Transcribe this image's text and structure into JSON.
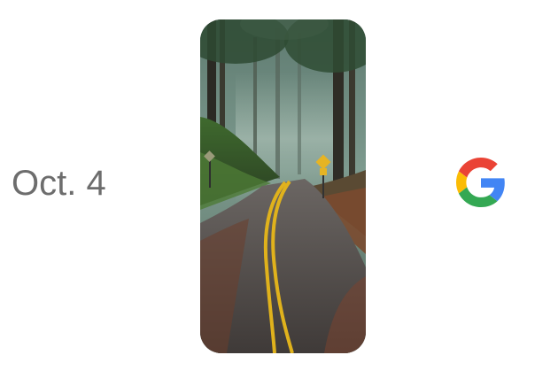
{
  "announcement": {
    "date_text": "Oct. 4"
  },
  "phone_image": {
    "description_icon": "forest-road-photo"
  },
  "logo": {
    "icon": "google-g-logo",
    "colors": {
      "blue": "#4285F4",
      "red": "#EA4335",
      "yellow": "#FBBC05",
      "green": "#34A853"
    }
  },
  "colors": {
    "background": "#ffffff",
    "date_text": "#6d6d6d"
  }
}
